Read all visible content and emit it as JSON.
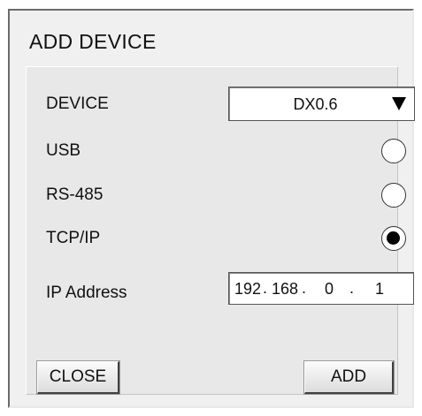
{
  "dialog": {
    "title": "ADD DEVICE"
  },
  "form": {
    "device": {
      "label": "DEVICE",
      "selected": "DX0.6"
    },
    "connections": [
      {
        "label": "USB",
        "selected": false
      },
      {
        "label": "RS-485",
        "selected": false
      },
      {
        "label": "TCP/IP",
        "selected": true
      }
    ],
    "ip": {
      "label": "IP Address",
      "octets": [
        "192",
        "168",
        "0",
        "1"
      ],
      "separator": "."
    }
  },
  "buttons": {
    "close_label": "CLOSE",
    "add_label": "ADD"
  },
  "icons": {
    "dropdown": "triangle-down-icon",
    "radio_selected": "radio-filled-icon",
    "radio_unselected": "radio-empty-icon"
  }
}
